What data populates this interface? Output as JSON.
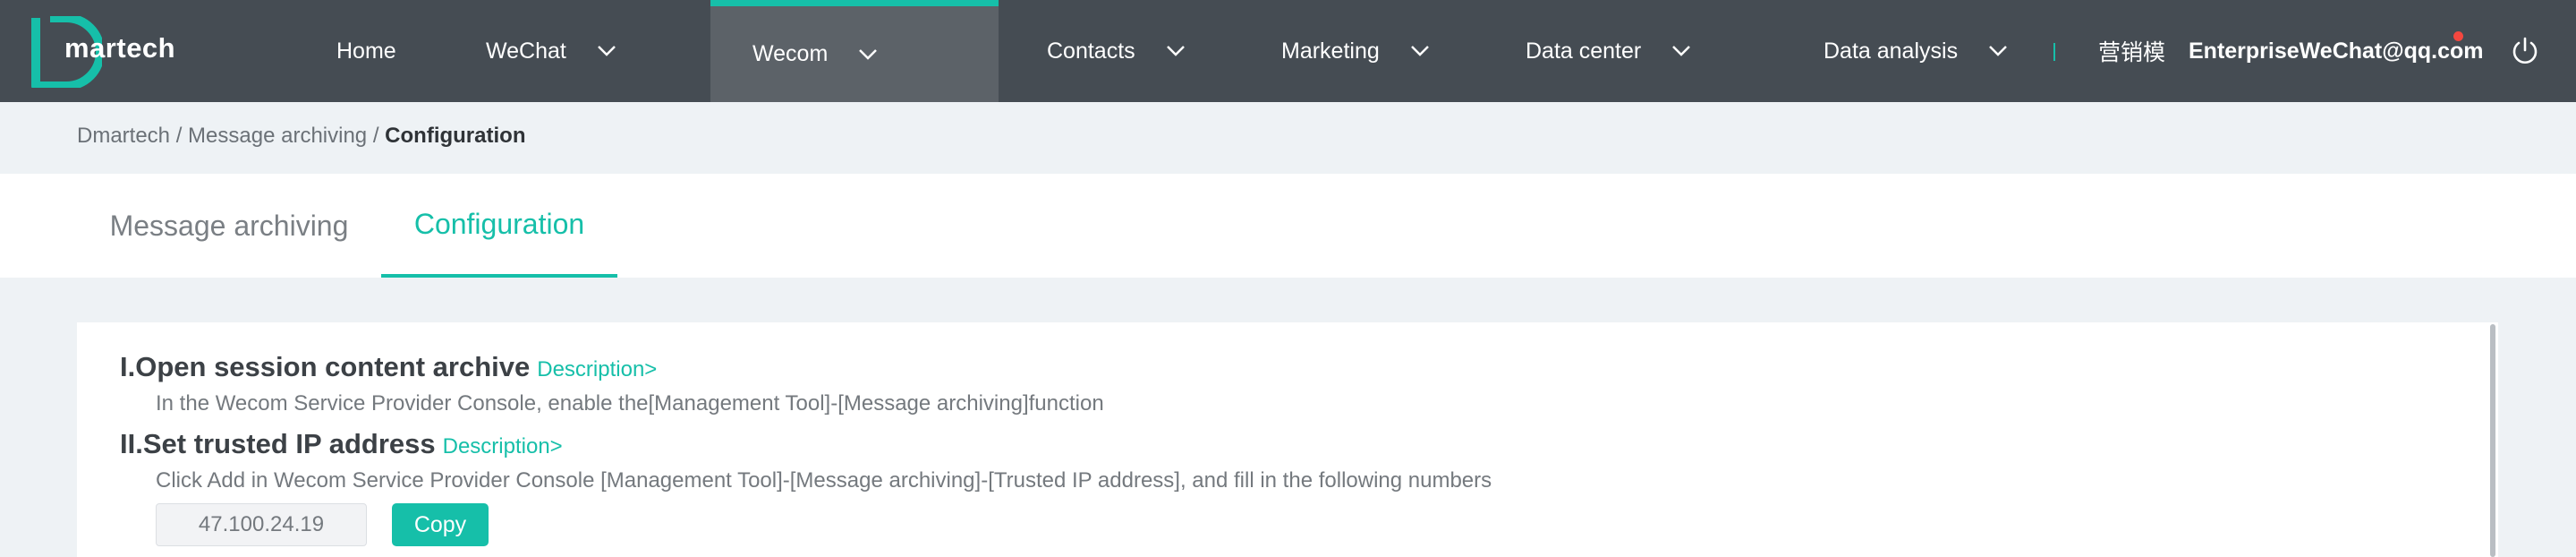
{
  "brand": {
    "logo_text": "martech",
    "accent_color": "#16bfa9"
  },
  "nav": {
    "items": [
      {
        "label": "Home",
        "dropdown": false
      },
      {
        "label": "WeChat",
        "dropdown": true
      },
      {
        "label": "Wecom",
        "dropdown": true,
        "active": true
      },
      {
        "label": "Contacts",
        "dropdown": true
      },
      {
        "label": "Marketing",
        "dropdown": true
      },
      {
        "label": "Data center",
        "dropdown": true
      },
      {
        "label": "Data analysis",
        "dropdown": true
      }
    ],
    "cn_label": "营销模",
    "user": "EnterpriseWeChat@qq.com",
    "power_icon": "power-icon",
    "chevron_icon": "chevron-down-icon"
  },
  "breadcrumb": {
    "items": [
      "Dmartech",
      "Message archiving"
    ],
    "separator": "/",
    "current": "Configuration"
  },
  "tabs": [
    {
      "label": "Message archiving",
      "active": false
    },
    {
      "label": "Configuration",
      "active": true
    }
  ],
  "sections": [
    {
      "title": "I.Open session content archive",
      "desc_link": "Description>",
      "text": "In the Wecom Service Provider Console, enable the[Management Tool]-[Message archiving]function"
    },
    {
      "title": "II.Set trusted IP address",
      "desc_link": "Description>",
      "text": "Click Add in Wecom Service Provider Console [Management Tool]-[Message archiving]-[Trusted IP address], and fill in the following numbers"
    }
  ],
  "ip": {
    "value": "47.100.24.19",
    "copy_label": "Copy"
  }
}
